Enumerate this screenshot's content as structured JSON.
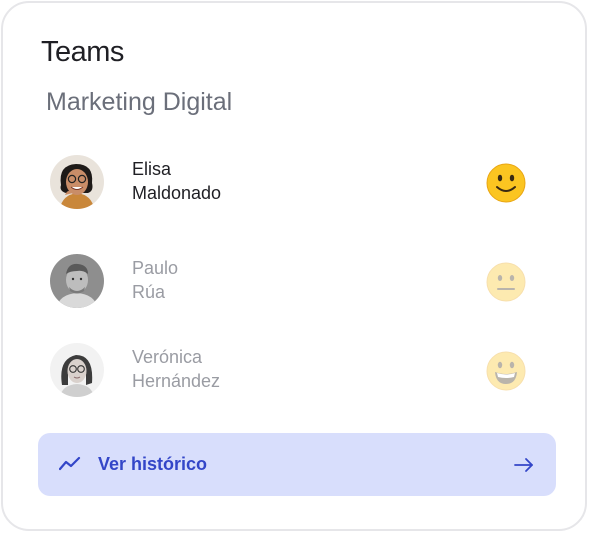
{
  "card": {
    "title": "Teams",
    "team_name": "Marketing Digital"
  },
  "members": [
    {
      "first": "Elisa",
      "last": "Maldonado",
      "mood": "slightly-smiling-face-icon",
      "active": true
    },
    {
      "first": "Paulo",
      "last": "Rúa",
      "mood": "neutral-face-icon",
      "active": false
    },
    {
      "first": "Verónica",
      "last": "Hernández",
      "mood": "grinning-face-icon",
      "active": false
    }
  ],
  "history_button": {
    "label": "Ver histórico",
    "icon": "trend-line-icon",
    "arrow_icon": "arrow-right-icon"
  },
  "colors": {
    "button_bg": "#d8defc",
    "button_text": "#3346c8",
    "emoji_yellow": "#fbc521"
  }
}
